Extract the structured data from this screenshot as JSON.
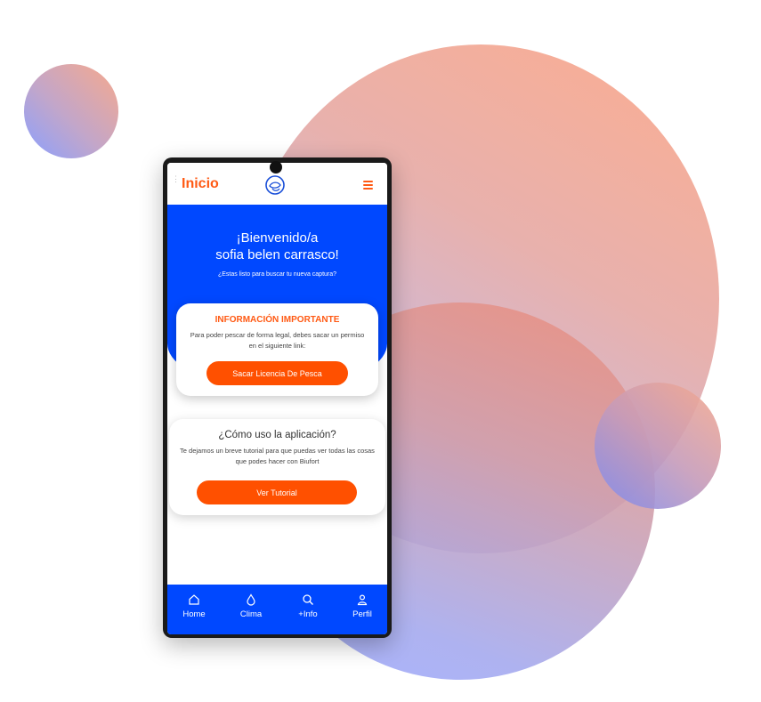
{
  "header": {
    "title": "Inicio",
    "logo_icon": "fish-logo-icon",
    "menu_icon": "hamburger-icon"
  },
  "hero": {
    "greeting_line1": "¡Bienvenido/a",
    "greeting_line2": "sofia belen carrasco!",
    "subtitle": "¿Estas listo para buscar tu nueva captura?"
  },
  "info_card": {
    "title": "INFORMACIÓN IMPORTANTE",
    "body": "Para poder pescar de forma legal, debes sacar un permiso en el siguiente link:",
    "button_label": "Sacar Licencia De Pesca"
  },
  "tutorial_card": {
    "title": "¿Cómo uso la aplicación?",
    "body": "Te dejamos un breve tutorial para que puedas ver todas las cosas que podes hacer con Biufort",
    "button_label": "Ver Tutorial"
  },
  "bottom_nav": [
    {
      "label": "Home",
      "icon": "home-icon"
    },
    {
      "label": "Clima",
      "icon": "drop-icon"
    },
    {
      "label": "+Info",
      "icon": "search-icon"
    },
    {
      "label": "Perfil",
      "icon": "user-icon"
    }
  ],
  "colors": {
    "accent": "#ff5a14",
    "primary": "#0048ff"
  }
}
